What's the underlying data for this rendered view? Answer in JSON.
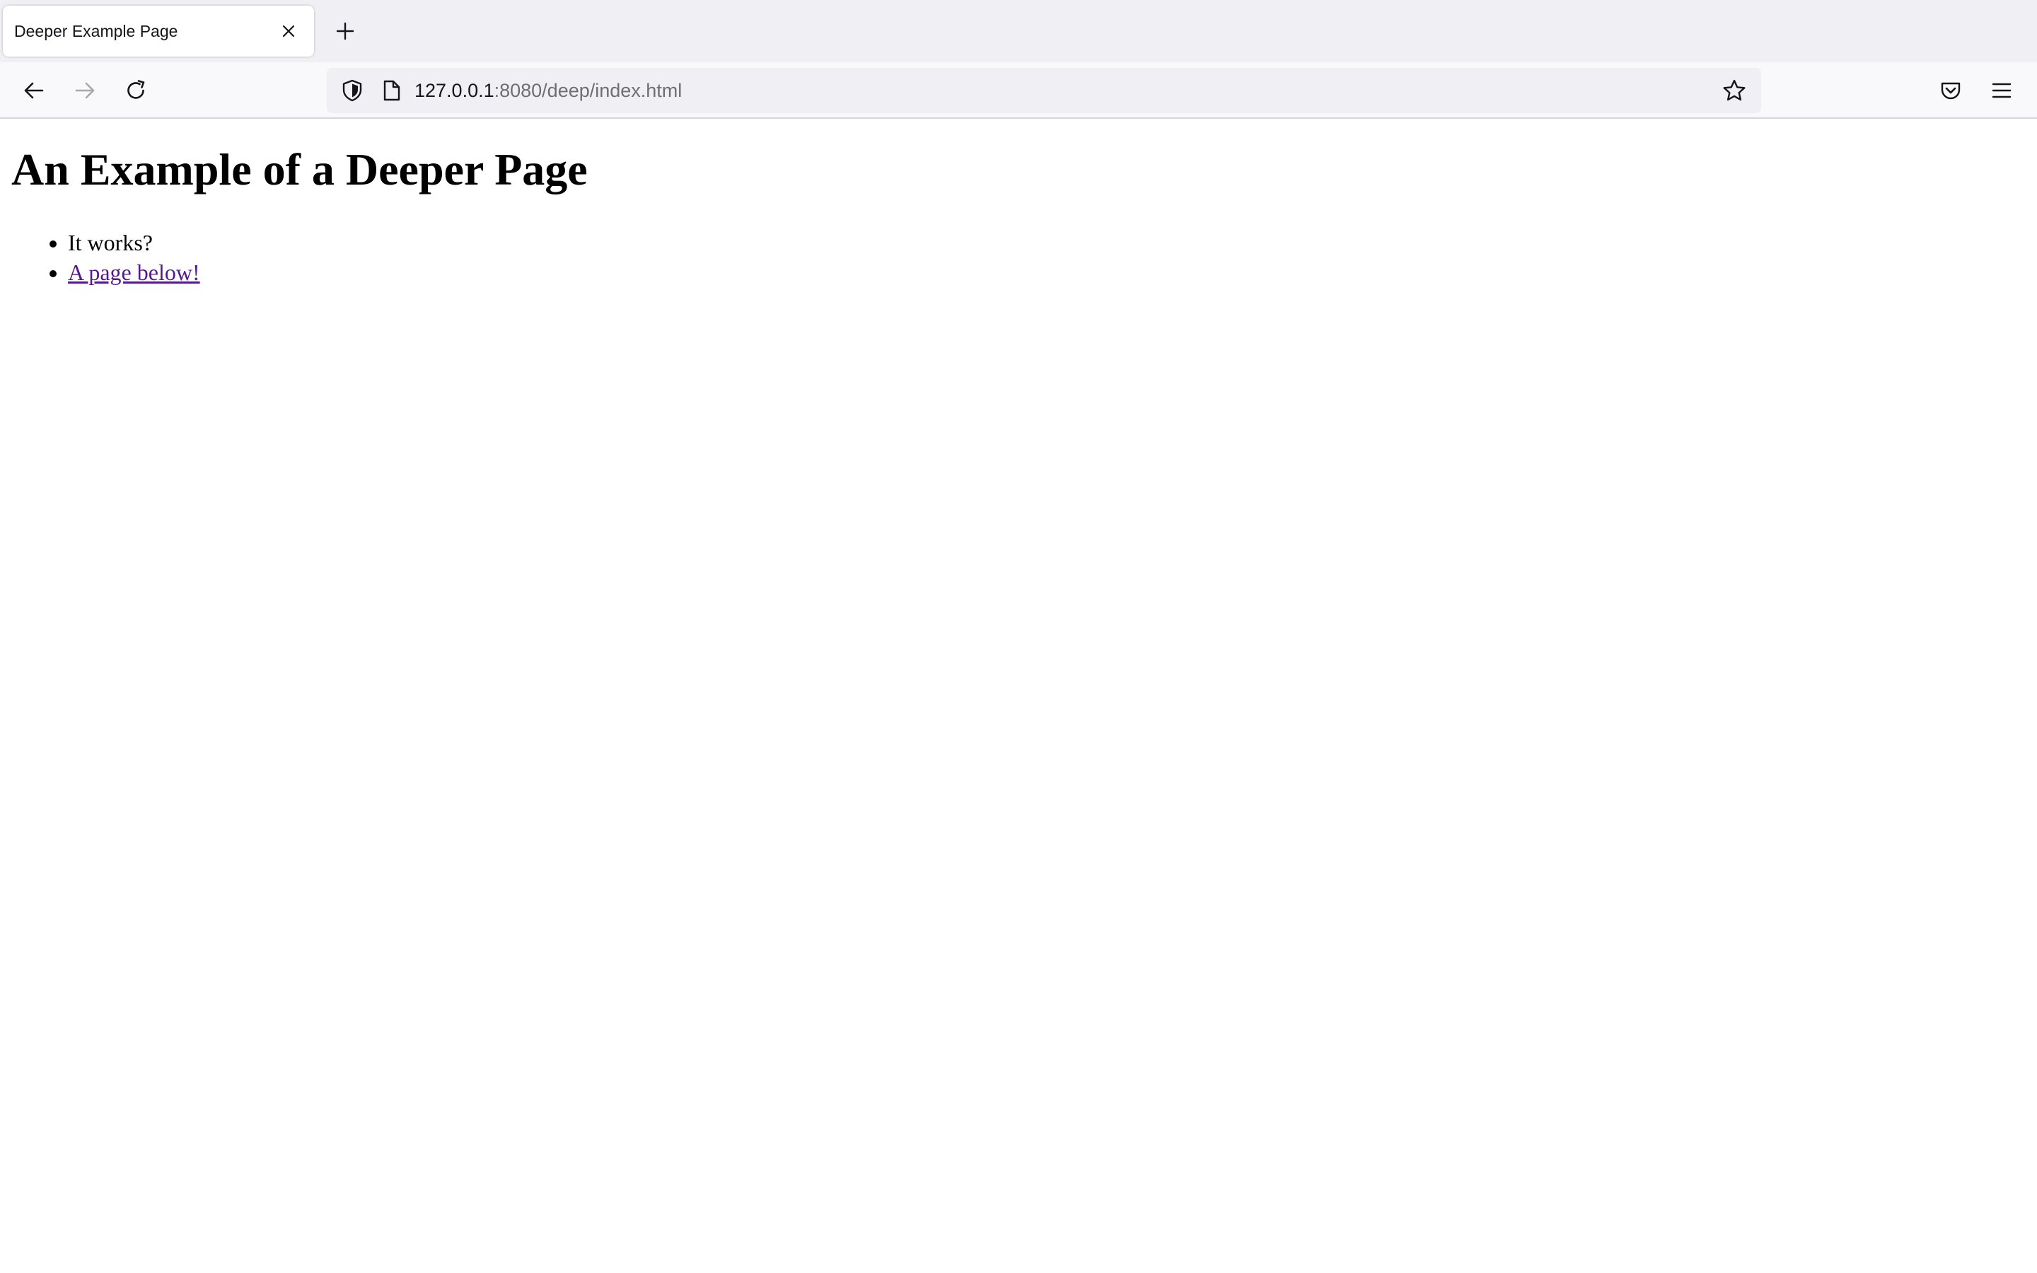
{
  "browser": {
    "tabs": [
      {
        "title": "Deeper Example Page",
        "active": true
      }
    ],
    "address_bar": {
      "host": "127.0.0.1",
      "rest": ":8080/deep/index.html"
    },
    "icons": {
      "tab_close": "close-icon",
      "new_tab": "plus-icon",
      "back": "arrow-left-icon",
      "forward": "arrow-right-icon",
      "reload": "reload-icon",
      "tracking": "shield-icon",
      "page_info": "page-icon",
      "bookmark": "star-icon",
      "pocket": "pocket-icon",
      "menu": "hamburger-menu-icon"
    },
    "colors": {
      "tabstrip_bg": "#f0f0f4",
      "toolbar_bg": "#f9f9fb",
      "urlbar_bg": "#f0f0f4",
      "visited_link": "#551a8b"
    }
  },
  "page": {
    "heading": "An Example of a Deeper Page",
    "items": [
      {
        "text": "It works?",
        "link": false
      },
      {
        "text": "A page below!",
        "link": true
      }
    ]
  }
}
